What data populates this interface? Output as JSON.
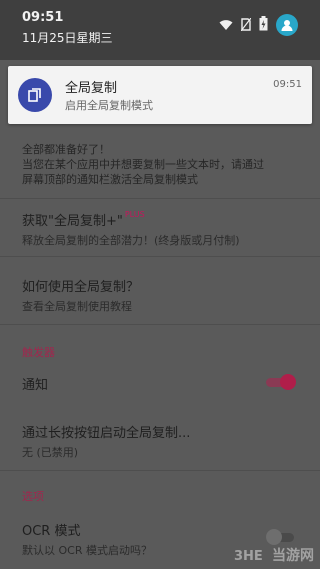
{
  "status": {
    "time": "09:51",
    "date": "11月25日星期三"
  },
  "notification": {
    "title": "全局复制",
    "text": "启用全局复制模式",
    "time": "09:51",
    "icon": "copy-icon",
    "accent": "#3949ab"
  },
  "intro": {
    "line1": "全部都准备好了！",
    "line2": "当您在某个应用中并想要复制一些文本时，请通过",
    "line3": "屏幕顶部的通知栏激活全局复制模式"
  },
  "items": [
    {
      "title": "获取\"全局复制+\"",
      "badge": "PLUS",
      "subtitle": "释放全局复制的全部潜力！(终身版或月付制)"
    },
    {
      "title": "如何使用全局复制？",
      "subtitle": "查看全局复制使用教程"
    }
  ],
  "trigger_section": {
    "header": "触发器",
    "notify_label": "通知",
    "notify_enabled": true,
    "longpress_title": "通过长按按钮启动全局复制...",
    "longpress_sub": "无 (已禁用)"
  },
  "options_section": {
    "header": "选项",
    "ocr_title": "OCR 模式",
    "ocr_sub": "默认以 OCR 模式启动吗？",
    "ocr_enabled": false
  },
  "watermark": {
    "text": "当游网"
  },
  "colors": {
    "accent": "#b01e4a",
    "section": "#a0274e",
    "avatar": "#29a7c9"
  }
}
